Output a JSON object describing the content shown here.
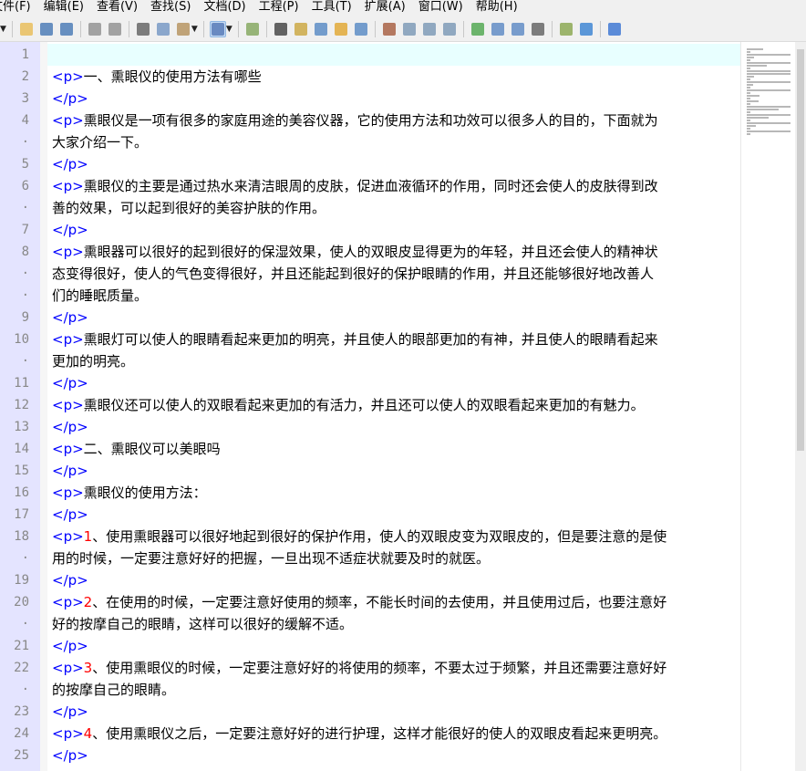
{
  "menu": [
    "文件(F)",
    "编辑(E)",
    "查看(V)",
    "查找(S)",
    "文档(D)",
    "工程(P)",
    "工具(T)",
    "扩展(A)",
    "窗口(W)",
    "帮助(H)"
  ],
  "toolbar": {
    "icons": [
      "dropdown-arrow-icon",
      "open-folder-icon",
      "save-icon",
      "save-all-icon",
      "undo-icon",
      "redo-icon",
      "cut-icon",
      "copy-icon",
      "paste-icon",
      "paste-dropdown-icon",
      "word-wrap-icon",
      "word-wrap-dropdown-icon",
      "view-icon",
      "find-icon",
      "replace-icon",
      "find-in-files-icon",
      "zoom-in-icon",
      "zoom-out-icon",
      "record-macro-icon",
      "run-icon",
      "run2-icon",
      "run3-icon",
      "tree-icon",
      "panel-icon",
      "panel2-icon",
      "browser-icon",
      "color-icon",
      "ie-icon",
      "help-icon"
    ]
  },
  "editor": {
    "line_numbers": [
      "1",
      "2",
      "3",
      "4",
      "·",
      "5",
      "6",
      "·",
      "7",
      "8",
      "·",
      "·",
      "9",
      "10",
      "·",
      "11",
      "12",
      "13",
      "14",
      "15",
      "16",
      "17",
      "18",
      "·",
      "19",
      "20",
      "·",
      "21",
      "22",
      "·",
      "23",
      "24",
      "25"
    ],
    "lines": [
      {
        "parts": []
      },
      {
        "parts": [
          {
            "t": "tag",
            "v": "<p>"
          },
          {
            "t": "txt",
            "v": "一、熏眼仪的使用方法有哪些"
          }
        ]
      },
      {
        "parts": [
          {
            "t": "tag",
            "v": "</p>"
          }
        ]
      },
      {
        "parts": [
          {
            "t": "tag",
            "v": "<p>"
          },
          {
            "t": "txt",
            "v": "熏眼仪是一项有很多的家庭用途的美容仪器，它的使用方法和功效可以很多人的目的，下面就为"
          }
        ]
      },
      {
        "parts": [
          {
            "t": "txt",
            "v": "大家介绍一下。"
          }
        ]
      },
      {
        "parts": [
          {
            "t": "tag",
            "v": "</p>"
          }
        ]
      },
      {
        "parts": [
          {
            "t": "tag",
            "v": "<p>"
          },
          {
            "t": "txt",
            "v": "熏眼仪的主要是通过热水来清洁眼周的皮肤，促进血液循环的作用，同时还会使人的皮肤得到改"
          }
        ]
      },
      {
        "parts": [
          {
            "t": "txt",
            "v": "善的效果，可以起到很好的美容护肤的作用。"
          }
        ]
      },
      {
        "parts": [
          {
            "t": "tag",
            "v": "</p>"
          }
        ]
      },
      {
        "parts": [
          {
            "t": "tag",
            "v": "<p>"
          },
          {
            "t": "txt",
            "v": "熏眼器可以很好的起到很好的保湿效果，使人的双眼皮显得更为的年轻，并且还会使人的精神状"
          }
        ]
      },
      {
        "parts": [
          {
            "t": "txt",
            "v": "态变得很好，使人的气色变得很好，并且还能起到很好的保护眼睛的作用，并且还能够很好地改善人"
          }
        ]
      },
      {
        "parts": [
          {
            "t": "txt",
            "v": "们的睡眠质量。"
          }
        ]
      },
      {
        "parts": [
          {
            "t": "tag",
            "v": "</p>"
          }
        ]
      },
      {
        "parts": [
          {
            "t": "tag",
            "v": "<p>"
          },
          {
            "t": "txt",
            "v": "熏眼灯可以使人的眼睛看起来更加的明亮，并且使人的眼部更加的有神，并且使人的眼睛看起来"
          }
        ]
      },
      {
        "parts": [
          {
            "t": "txt",
            "v": "更加的明亮。"
          }
        ]
      },
      {
        "parts": [
          {
            "t": "tag",
            "v": "</p>"
          }
        ]
      },
      {
        "parts": [
          {
            "t": "tag",
            "v": "<p>"
          },
          {
            "t": "txt",
            "v": "熏眼仪还可以使人的双眼看起来更加的有活力，并且还可以使人的双眼看起来更加的有魅力。"
          }
        ]
      },
      {
        "parts": [
          {
            "t": "tag",
            "v": "</p>"
          }
        ]
      },
      {
        "parts": [
          {
            "t": "tag",
            "v": "<p>"
          },
          {
            "t": "txt",
            "v": "二、熏眼仪可以美眼吗"
          }
        ]
      },
      {
        "parts": [
          {
            "t": "tag",
            "v": "</p>"
          }
        ]
      },
      {
        "parts": [
          {
            "t": "tag",
            "v": "<p>"
          },
          {
            "t": "txt",
            "v": "熏眼仪的使用方法："
          }
        ]
      },
      {
        "parts": [
          {
            "t": "tag",
            "v": "</p>"
          }
        ]
      },
      {
        "parts": [
          {
            "t": "tag",
            "v": "<p>"
          },
          {
            "t": "num",
            "v": "1"
          },
          {
            "t": "txt",
            "v": "、使用熏眼器可以很好地起到很好的保护作用，使人的双眼皮变为双眼皮的，但是要注意的是使"
          }
        ]
      },
      {
        "parts": [
          {
            "t": "txt",
            "v": "用的时候，一定要注意好好的把握，一旦出现不适症状就要及时的就医。"
          }
        ]
      },
      {
        "parts": [
          {
            "t": "tag",
            "v": "</p>"
          }
        ]
      },
      {
        "parts": [
          {
            "t": "tag",
            "v": "<p>"
          },
          {
            "t": "num",
            "v": "2"
          },
          {
            "t": "txt",
            "v": "、在使用的时候，一定要注意好使用的频率，不能长时间的去使用，并且使用过后，也要注意好"
          }
        ]
      },
      {
        "parts": [
          {
            "t": "txt",
            "v": "好的按摩自己的眼睛，这样可以很好的缓解不适。"
          }
        ]
      },
      {
        "parts": [
          {
            "t": "tag",
            "v": "</p>"
          }
        ]
      },
      {
        "parts": [
          {
            "t": "tag",
            "v": "<p>"
          },
          {
            "t": "num",
            "v": "3"
          },
          {
            "t": "txt",
            "v": "、使用熏眼仪的时候，一定要注意好好的将使用的频率，不要太过于频繁，并且还需要注意好好"
          }
        ]
      },
      {
        "parts": [
          {
            "t": "txt",
            "v": "的按摩自己的眼睛。"
          }
        ]
      },
      {
        "parts": [
          {
            "t": "tag",
            "v": "</p>"
          }
        ]
      },
      {
        "parts": [
          {
            "t": "tag",
            "v": "<p>"
          },
          {
            "t": "num",
            "v": "4"
          },
          {
            "t": "txt",
            "v": "、使用熏眼仪之后，一定要注意好好的进行护理，这样才能很好的使人的双眼皮看起来更明亮。"
          }
        ]
      },
      {
        "parts": [
          {
            "t": "tag",
            "v": "</p>"
          }
        ]
      }
    ]
  }
}
